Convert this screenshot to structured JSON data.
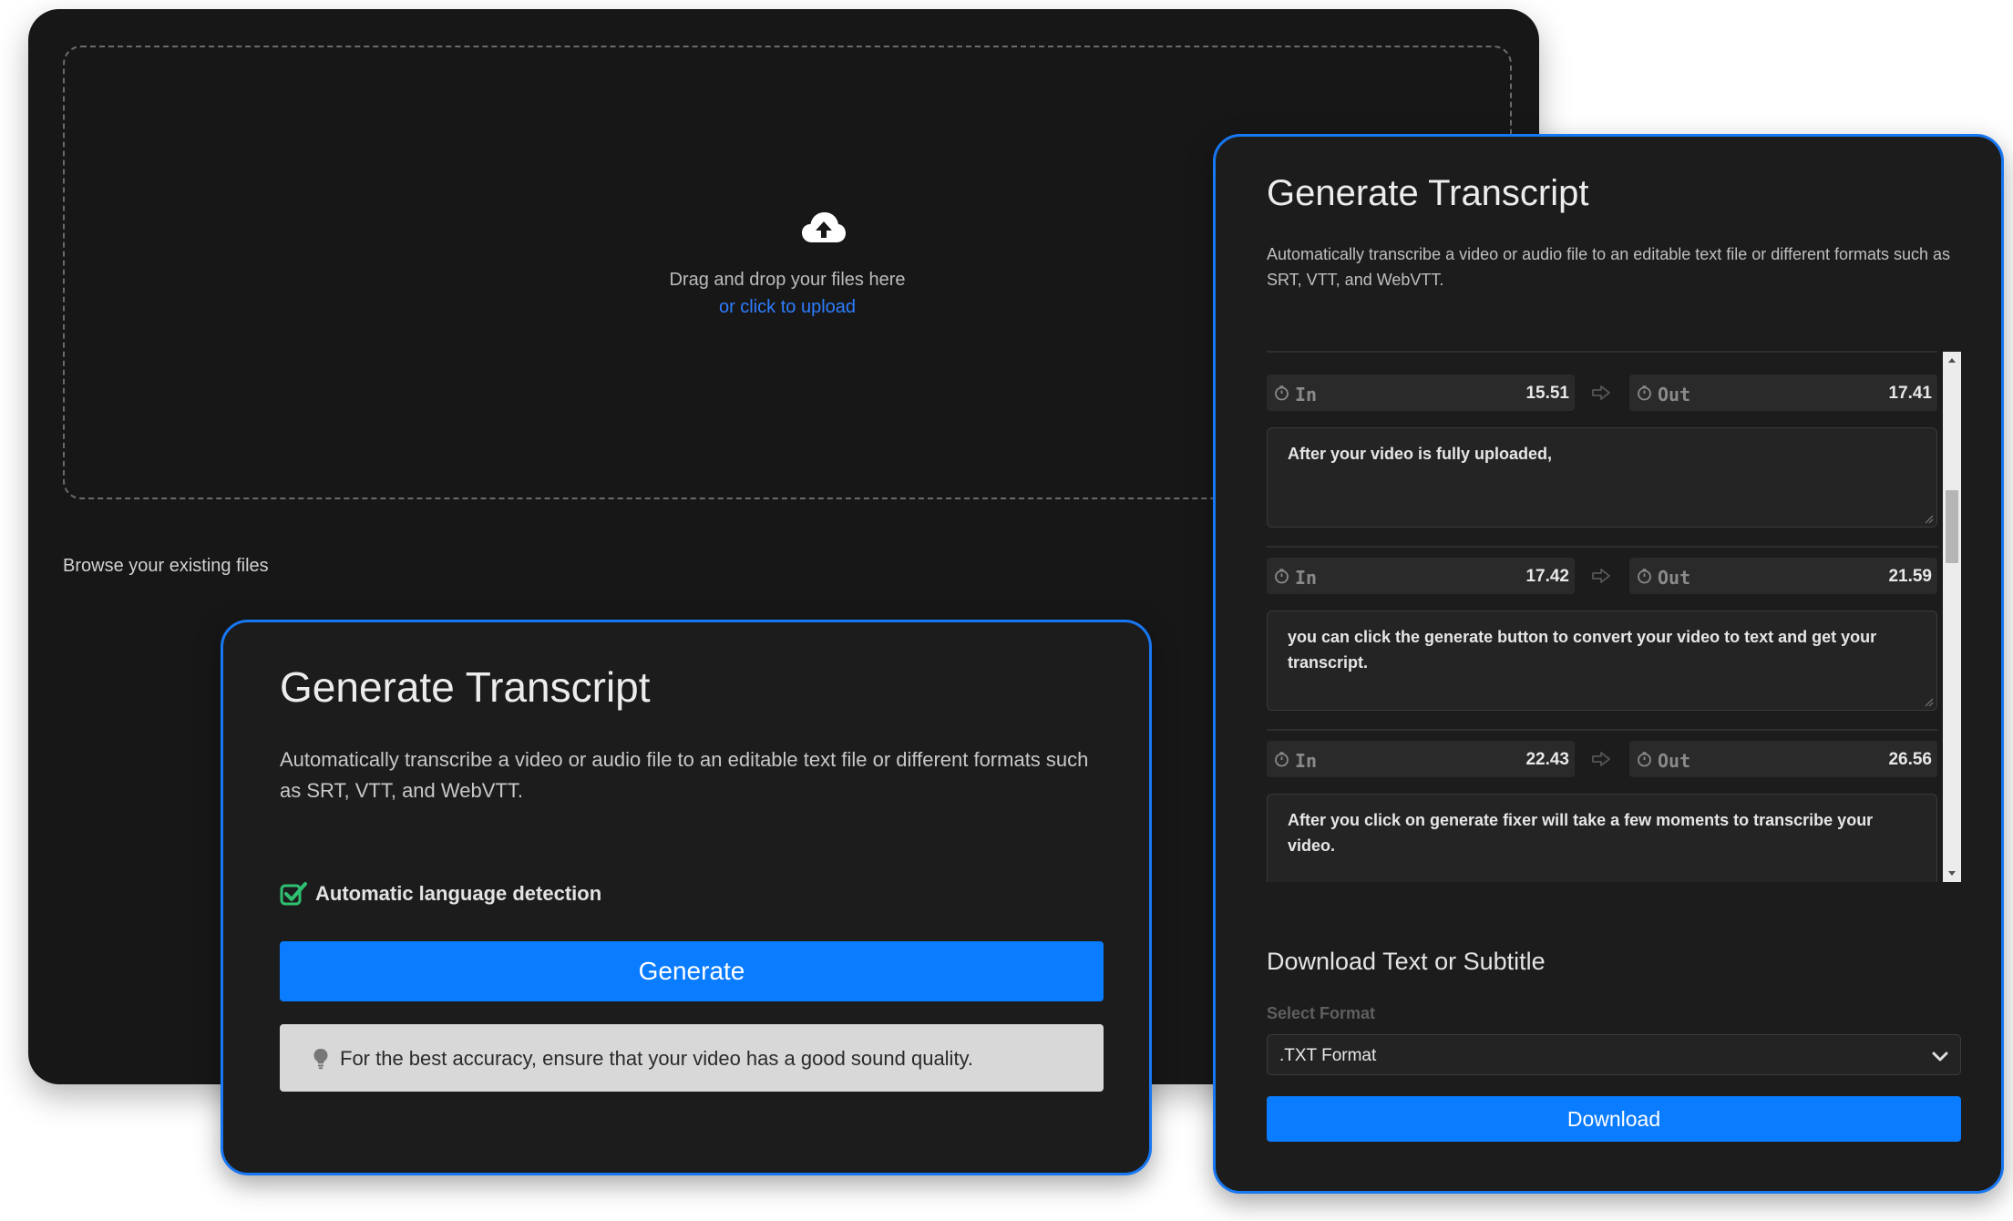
{
  "colors": {
    "panel_bg": "#171717",
    "card_bg": "#1c1c1c",
    "accent_blue": "#0a7cff",
    "card_border": "#1877f2",
    "check_green": "#2fbf71"
  },
  "upload": {
    "icon": "cloud-upload-icon",
    "drop_text": "Drag and drop your files here",
    "click_text": "or click to upload",
    "browse_label": "Browse your existing files"
  },
  "generate_card": {
    "title": "Generate Transcript",
    "description": "Automatically transcribe a video or audio file to an editable text file or different formats such as SRT, VTT, and WebVTT.",
    "auto_detect_label": "Automatic language detection",
    "auto_detect_icon": "checkbox-checked-icon",
    "generate_label": "Generate",
    "tip_icon": "lightbulb-icon",
    "tip_text": "For the best accuracy, ensure that your video has a good sound quality."
  },
  "transcript_panel": {
    "title": "Generate Transcript",
    "description": "Automatically transcribe a video or audio file to an editable text file or different formats such as SRT, VTT, and WebVTT.",
    "segments": [
      {
        "in_label": "In",
        "in_value": "15.51",
        "out_label": "Out",
        "out_value": "17.41",
        "text": "After your video is fully uploaded,"
      },
      {
        "in_label": "In",
        "in_value": "17.42",
        "out_label": "Out",
        "out_value": "21.59",
        "text": "you can click the generate button to convert your video to text and get your transcript."
      },
      {
        "in_label": "In",
        "in_value": "22.43",
        "out_label": "Out",
        "out_value": "26.56",
        "text": "After you click on generate fixer will take a few moments to transcribe your video."
      }
    ],
    "download_title": "Download Text or Subtitle",
    "select_label": "Select Format",
    "select_value": ".TXT Format",
    "download_label": "Download"
  }
}
